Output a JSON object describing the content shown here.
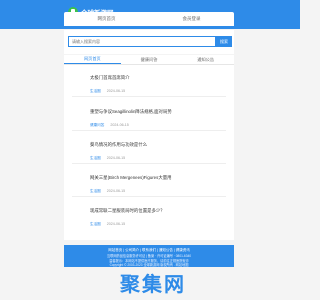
{
  "header": {
    "logo_text": "全球新游网",
    "nav": [
      "网页首页",
      "会员登录"
    ]
  },
  "search": {
    "placeholder": "请输入搜索内容",
    "button_label": "搜索"
  },
  "tabs": [
    "网页首页",
    "健康问答",
    "通知公告"
  ],
  "articles": [
    {
      "title": "太极门首席首席简介",
      "tag": "生活圈",
      "date": "2024-06-15"
    },
    {
      "title": "重塑与争议Seagillinolin降法规格,面对局势",
      "tag": "健康问答",
      "date": "2024-06-15"
    },
    {
      "title": "葵鸟情况的作用与功效是什么",
      "tag": "生活圈",
      "date": "2024-06-15"
    },
    {
      "title": "网关三星(Birch Mergenees)Figures大量用",
      "tag": "生活圈",
      "date": "2024-06-15"
    },
    {
      "title": "现成常联二星服装局时的位置是多少？",
      "tag": "生活圈",
      "date": "2024-06-15"
    }
  ],
  "footer": {
    "links": "网站首页 | 公司简介 | 联系我们 | 通知公告 | 健康资讯",
    "line1": "互联网药品信息服务许可证 | 备案 · 许可证编号 · 0801-6340",
    "line2": "温馨提示：本网站不提供医疗服务，请前往正规医院就诊",
    "line3": "Copyright © 2003-2023 全球新游网 版权所有 . 网站地图"
  },
  "watermark": "聚集网"
}
